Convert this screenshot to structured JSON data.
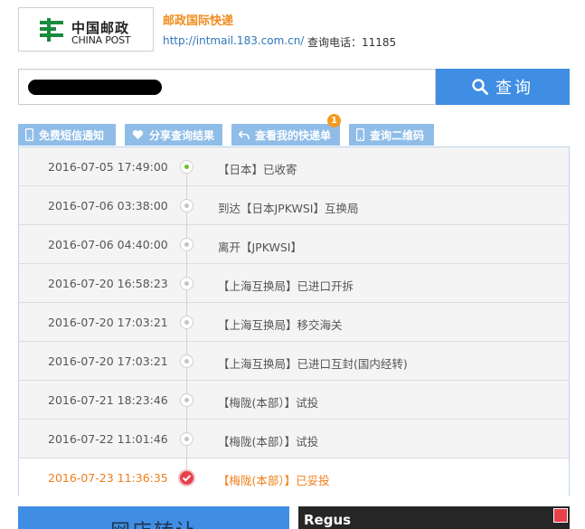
{
  "logo": {
    "cn": "中国邮政",
    "en": "CHINA POST"
  },
  "header": {
    "site_name": "邮政国际快递",
    "url": "http://intmail.183.com.cn/",
    "phone_label": "查询电话：11185"
  },
  "search": {
    "button_label": "查询"
  },
  "tabs": [
    {
      "label": "免费短信通知",
      "icon": "phone-icon"
    },
    {
      "label": "分享查询结果",
      "icon": "heart-icon"
    },
    {
      "label": "查看我的快递单",
      "icon": "reply-arrow-icon",
      "badge": "1"
    },
    {
      "label": "查询二维码",
      "icon": "phone-icon"
    }
  ],
  "tracking": [
    {
      "time": "2016-07-05 17:49:00",
      "desc": "【日本】已收寄"
    },
    {
      "time": "2016-07-06 03:38:00",
      "desc": "到达【日本JPKWSI】互换局"
    },
    {
      "time": "2016-07-06 04:40:00",
      "desc": "离开【JPKWSI】"
    },
    {
      "time": "2016-07-20 16:58:23",
      "desc": "【上海互换局】已进口开拆"
    },
    {
      "time": "2016-07-20 17:03:21",
      "desc": "【上海互换局】移交海关"
    },
    {
      "time": "2016-07-20 17:03:21",
      "desc": "【上海互换局】已进口互封(国内经转)"
    },
    {
      "time": "2016-07-21 18:23:46",
      "desc": "【梅陇(本部）】试投"
    },
    {
      "time": "2016-07-22 11:01:46",
      "desc": "【梅陇(本部）】试投"
    },
    {
      "time": "2016-07-23 11:36:35",
      "desc": "【梅陇(本部）】已妥投"
    }
  ],
  "ads": {
    "left_text": "网店转让",
    "right_text": "Regus"
  },
  "colors": {
    "brand_blue": "#3f8ee3",
    "tab_blue": "#8fbde8",
    "orange": "#f08c1e",
    "delivered_red": "#e8414b",
    "first_green": "#6cc323"
  }
}
